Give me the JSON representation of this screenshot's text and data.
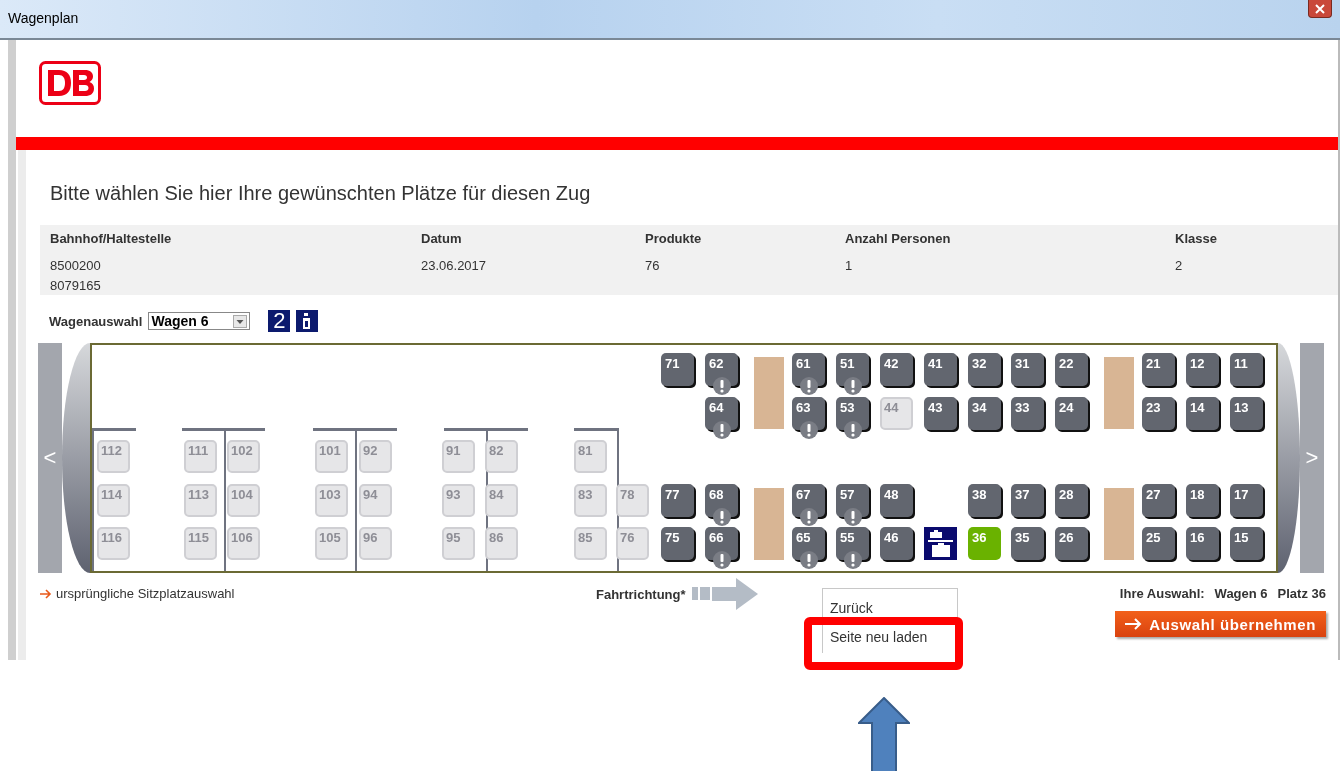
{
  "window": {
    "title": "Wagenplan"
  },
  "heading": "Bitte wählen Sie hier Ihre gewünschten Plätze für diesen Zug",
  "info": {
    "columns": [
      {
        "label": "Bahnhof/Haltestelle",
        "values": [
          "8500200",
          "8079165"
        ]
      },
      {
        "label": "Datum",
        "values": [
          "23.06.2017"
        ]
      },
      {
        "label": "Produkte",
        "values": [
          "76"
        ]
      },
      {
        "label": "Anzahl Personen",
        "values": [
          "1"
        ]
      },
      {
        "label": "Klasse",
        "values": [
          "2"
        ]
      }
    ]
  },
  "wagon_select": {
    "label": "Wagenauswahl",
    "value": "Wagen 6",
    "class_badge": "2"
  },
  "coach": {
    "prev": "<",
    "next": ">",
    "rows": [
      [
        {
          "kind": "empty"
        },
        {
          "kind": "empty"
        },
        {
          "kind": "empty"
        },
        {
          "kind": "empty"
        },
        {
          "kind": "empty"
        },
        {
          "kind": "empty"
        },
        {
          "kind": "empty"
        },
        {
          "kind": "empty"
        },
        {
          "kind": "empty"
        },
        {
          "kind": "seat",
          "number": "71",
          "available": true,
          "selected": false,
          "notice": false
        },
        {
          "kind": "seat",
          "number": "62",
          "available": true,
          "selected": false,
          "notice": true
        },
        {
          "kind": "table"
        },
        {
          "kind": "seat",
          "number": "61",
          "available": true,
          "selected": false,
          "notice": true
        },
        {
          "kind": "seat",
          "number": "51",
          "available": true,
          "selected": false,
          "notice": true
        },
        {
          "kind": "seat",
          "number": "42",
          "available": true,
          "selected": false,
          "notice": false
        },
        {
          "kind": "seat",
          "number": "41",
          "available": true,
          "selected": false,
          "notice": false
        },
        {
          "kind": "seat",
          "number": "32",
          "available": true,
          "selected": false,
          "notice": false
        },
        {
          "kind": "seat",
          "number": "31",
          "available": true,
          "selected": false,
          "notice": false
        },
        {
          "kind": "seat",
          "number": "22",
          "available": true,
          "selected": false,
          "notice": false
        },
        {
          "kind": "table"
        },
        {
          "kind": "seat",
          "number": "21",
          "available": true,
          "selected": false,
          "notice": false
        },
        {
          "kind": "seat",
          "number": "12",
          "available": true,
          "selected": false,
          "notice": false
        },
        {
          "kind": "seat",
          "number": "11",
          "available": true,
          "selected": false,
          "notice": false
        }
      ],
      [
        {
          "kind": "empty"
        },
        {
          "kind": "empty"
        },
        {
          "kind": "empty"
        },
        {
          "kind": "empty"
        },
        {
          "kind": "empty"
        },
        {
          "kind": "empty"
        },
        {
          "kind": "empty"
        },
        {
          "kind": "empty"
        },
        {
          "kind": "empty"
        },
        {
          "kind": "empty"
        },
        {
          "kind": "seat",
          "number": "64",
          "available": true,
          "selected": false,
          "notice": true
        },
        {
          "kind": "seat",
          "number": "63",
          "available": true,
          "selected": false,
          "notice": true
        },
        {
          "kind": "seat",
          "number": "53",
          "available": true,
          "selected": false,
          "notice": true
        },
        {
          "kind": "seat",
          "number": "44",
          "available": false,
          "selected": false,
          "notice": false
        },
        {
          "kind": "seat",
          "number": "43",
          "available": true,
          "selected": false,
          "notice": false
        },
        {
          "kind": "seat",
          "number": "34",
          "available": true,
          "selected": false,
          "notice": false
        },
        {
          "kind": "seat",
          "number": "33",
          "available": true,
          "selected": false,
          "notice": false
        },
        {
          "kind": "seat",
          "number": "24",
          "available": true,
          "selected": false,
          "notice": false
        },
        {
          "kind": "seat",
          "number": "23",
          "available": true,
          "selected": false,
          "notice": false
        },
        {
          "kind": "seat",
          "number": "14",
          "available": true,
          "selected": false,
          "notice": false
        },
        {
          "kind": "seat",
          "number": "13",
          "available": true,
          "selected": false,
          "notice": false
        }
      ],
      [
        {
          "kind": "seat",
          "number": "112",
          "available": false,
          "selected": false,
          "notice": false
        },
        {
          "kind": "seat",
          "number": "111",
          "available": false,
          "selected": false,
          "notice": false
        },
        {
          "kind": "seat",
          "number": "102",
          "available": false,
          "selected": false,
          "notice": false
        },
        {
          "kind": "seat",
          "number": "101",
          "available": false,
          "selected": false,
          "notice": false
        },
        {
          "kind": "seat",
          "number": "92",
          "available": false,
          "selected": false,
          "notice": false
        },
        {
          "kind": "seat",
          "number": "91",
          "available": false,
          "selected": false,
          "notice": false
        },
        {
          "kind": "seat",
          "number": "82",
          "available": false,
          "selected": false,
          "notice": false
        },
        {
          "kind": "seat",
          "number": "81",
          "available": false,
          "selected": false,
          "notice": false
        },
        {
          "kind": "empty"
        },
        {
          "kind": "empty"
        },
        {
          "kind": "empty"
        },
        {
          "kind": "empty"
        },
        {
          "kind": "empty"
        },
        {
          "kind": "empty"
        },
        {
          "kind": "empty"
        },
        {
          "kind": "empty"
        },
        {
          "kind": "empty"
        },
        {
          "kind": "empty"
        },
        {
          "kind": "empty"
        },
        {
          "kind": "empty"
        },
        {
          "kind": "empty"
        },
        {
          "kind": "empty"
        },
        {
          "kind": "empty"
        }
      ],
      [
        {
          "kind": "seat",
          "number": "114",
          "available": false,
          "selected": false,
          "notice": false
        },
        {
          "kind": "seat",
          "number": "113",
          "available": false,
          "selected": false,
          "notice": false
        },
        {
          "kind": "seat",
          "number": "104",
          "available": false,
          "selected": false,
          "notice": false
        },
        {
          "kind": "seat",
          "number": "103",
          "available": false,
          "selected": false,
          "notice": false
        },
        {
          "kind": "seat",
          "number": "94",
          "available": false,
          "selected": false,
          "notice": false
        },
        {
          "kind": "seat",
          "number": "93",
          "available": false,
          "selected": false,
          "notice": false
        },
        {
          "kind": "seat",
          "number": "84",
          "available": false,
          "selected": false,
          "notice": false
        },
        {
          "kind": "seat",
          "number": "83",
          "available": false,
          "selected": false,
          "notice": false
        },
        {
          "kind": "seat",
          "number": "78",
          "available": false,
          "selected": false,
          "notice": false
        },
        {
          "kind": "seat",
          "number": "77",
          "available": true,
          "selected": false,
          "notice": false
        },
        {
          "kind": "seat",
          "number": "68",
          "available": true,
          "selected": false,
          "notice": true
        },
        {
          "kind": "table"
        },
        {
          "kind": "seat",
          "number": "67",
          "available": true,
          "selected": false,
          "notice": true
        },
        {
          "kind": "seat",
          "number": "57",
          "available": true,
          "selected": false,
          "notice": true
        },
        {
          "kind": "seat",
          "number": "48",
          "available": true,
          "selected": false,
          "notice": false
        },
        {
          "kind": "empty"
        },
        {
          "kind": "seat",
          "number": "38",
          "available": true,
          "selected": false,
          "notice": false
        },
        {
          "kind": "seat",
          "number": "37",
          "available": true,
          "selected": false,
          "notice": false
        },
        {
          "kind": "seat",
          "number": "28",
          "available": true,
          "selected": false,
          "notice": false
        },
        {
          "kind": "table"
        },
        {
          "kind": "seat",
          "number": "27",
          "available": true,
          "selected": false,
          "notice": false
        },
        {
          "kind": "seat",
          "number": "18",
          "available": true,
          "selected": false,
          "notice": false
        },
        {
          "kind": "seat",
          "number": "17",
          "available": true,
          "selected": false,
          "notice": false
        }
      ],
      [
        {
          "kind": "seat",
          "number": "116",
          "available": false,
          "selected": false,
          "notice": false
        },
        {
          "kind": "seat",
          "number": "115",
          "available": false,
          "selected": false,
          "notice": false
        },
        {
          "kind": "seat",
          "number": "106",
          "available": false,
          "selected": false,
          "notice": false
        },
        {
          "kind": "seat",
          "number": "105",
          "available": false,
          "selected": false,
          "notice": false
        },
        {
          "kind": "seat",
          "number": "96",
          "available": false,
          "selected": false,
          "notice": false
        },
        {
          "kind": "seat",
          "number": "95",
          "available": false,
          "selected": false,
          "notice": false
        },
        {
          "kind": "seat",
          "number": "86",
          "available": false,
          "selected": false,
          "notice": false
        },
        {
          "kind": "seat",
          "number": "85",
          "available": false,
          "selected": false,
          "notice": false
        },
        {
          "kind": "seat",
          "number": "76",
          "available": false,
          "selected": false,
          "notice": false
        },
        {
          "kind": "seat",
          "number": "75",
          "available": true,
          "selected": false,
          "notice": false
        },
        {
          "kind": "seat",
          "number": "66",
          "available": true,
          "selected": false,
          "notice": true
        },
        {
          "kind": "seat",
          "number": "65",
          "available": true,
          "selected": false,
          "notice": true
        },
        {
          "kind": "seat",
          "number": "55",
          "available": true,
          "selected": false,
          "notice": true
        },
        {
          "kind": "seat",
          "number": "46",
          "available": true,
          "selected": false,
          "notice": false
        },
        {
          "kind": "luggage"
        },
        {
          "kind": "seat",
          "number": "36",
          "available": true,
          "selected": true,
          "notice": false
        },
        {
          "kind": "seat",
          "number": "35",
          "available": true,
          "selected": false,
          "notice": false
        },
        {
          "kind": "seat",
          "number": "26",
          "available": true,
          "selected": false,
          "notice": false
        },
        {
          "kind": "seat",
          "number": "25",
          "available": true,
          "selected": false,
          "notice": false
        },
        {
          "kind": "seat",
          "number": "16",
          "available": true,
          "selected": false,
          "notice": false
        },
        {
          "kind": "seat",
          "number": "15",
          "available": true,
          "selected": false,
          "notice": false
        }
      ]
    ]
  },
  "original_link": "ursprüngliche Sitzplatzauswahl",
  "direction_label": "Fahrtrichtung*",
  "selection": {
    "label": "Ihre Auswahl:",
    "wagon": "Wagen 6",
    "seat": "Platz 36"
  },
  "confirm_button": "Auswahl übernehmen",
  "context_menu": {
    "items": [
      "Zurück",
      "Seite neu laden"
    ]
  }
}
